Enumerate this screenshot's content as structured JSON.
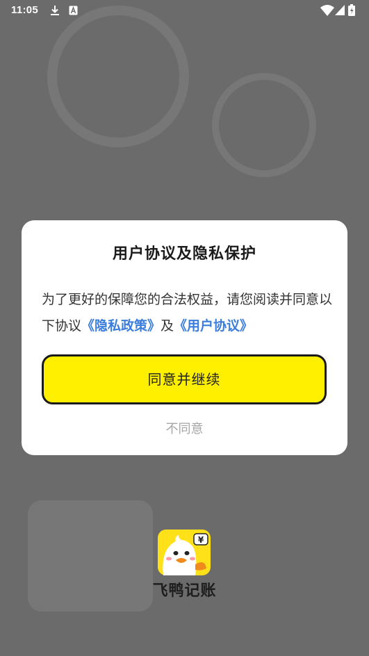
{
  "status_bar": {
    "time": "11:05",
    "left_icons": [
      "download-icon",
      "font-a-icon"
    ],
    "right_icons": [
      "wifi-icon",
      "signal-icon",
      "battery-icon"
    ]
  },
  "dialog": {
    "title": "用户协议及隐私保护",
    "message_part1": "为了更好的保障您的合法权益，请您阅读并同意以下协议",
    "privacy_link": "《隐私政策》",
    "conjunction": "及",
    "user_agreement_link": "《用户协议》",
    "agree_button": "同意并继续",
    "disagree_button": "不同意"
  },
  "app": {
    "name": "飞鸭记账",
    "logo_icon": "duck-logo-icon",
    "logo_badge": "¥"
  },
  "colors": {
    "scrim": "#6b6b6b",
    "dialog_bg": "#ffffff",
    "link": "#3b7ddd",
    "button_bg": "#fff000",
    "button_border": "#1a1a1a",
    "disagree_text": "#a6a6a6",
    "logo_bg": "#ffe11a"
  }
}
